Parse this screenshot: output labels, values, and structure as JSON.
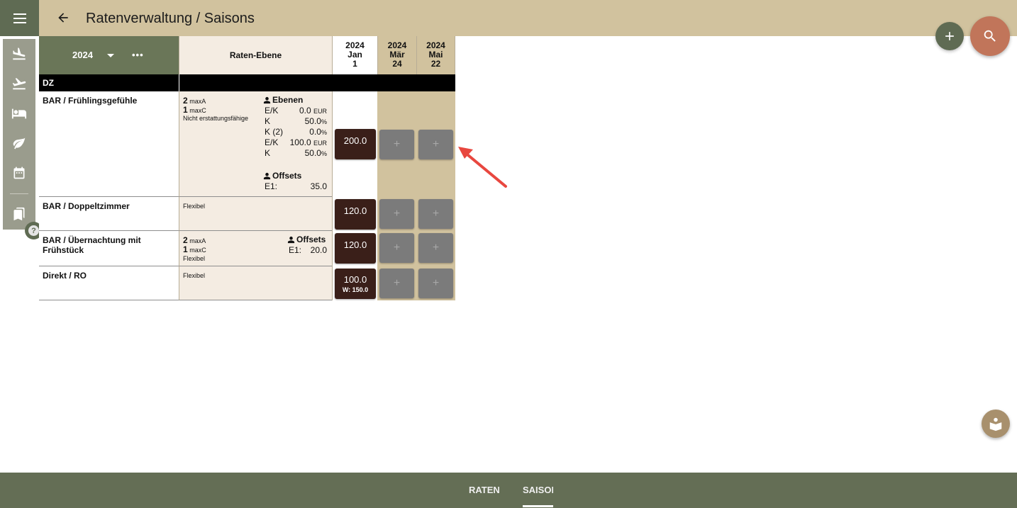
{
  "header": {
    "title": "Ratenverwaltung / Saisons"
  },
  "icons": {
    "menu": "menu-icon",
    "back": "arrow-left-icon",
    "add": "plus-icon",
    "search": "search-icon",
    "nav": [
      "plane-landing-icon",
      "plane-takeoff-icon",
      "bed-icon",
      "leaf-icon",
      "calendar-icon",
      "bookmarks-icon"
    ],
    "help": "help-icon",
    "person": "person-icon",
    "guide": "book-reader-icon",
    "annotation": "red-arrow-icon"
  },
  "help_label": "?",
  "grid": {
    "year": "2024",
    "more": "•••",
    "level_header": "Raten-Ebene",
    "dates": [
      {
        "year": "2024",
        "month": "Jan",
        "day": "1"
      },
      {
        "year": "2024",
        "month": "Mär",
        "day": "24"
      },
      {
        "year": "2024",
        "month": "Mai",
        "day": "22"
      }
    ],
    "category": "DZ",
    "add_symbol": "+",
    "rows": [
      {
        "name": "BAR / Frühlingsgefühle",
        "max_a": "2",
        "max_a_unit": "maxA",
        "max_c": "1",
        "max_c_unit": "maxC",
        "note": "Nicht erstattungsfähige",
        "ebenen_title": "Ebenen",
        "ebenen": [
          {
            "k": "E/K",
            "v": "0.0",
            "u": "EUR"
          },
          {
            "k": "K",
            "v": "50.0",
            "u": "%"
          },
          {
            "k": "K (2)",
            "v": "0.0",
            "u": "%"
          },
          {
            "k": "E/K",
            "v": "100.0",
            "u": "EUR"
          },
          {
            "k": "K",
            "v": "50.0",
            "u": "%"
          }
        ],
        "offsets_title": "Offsets",
        "offsets": [
          {
            "k": "E1:",
            "v": "35.0"
          }
        ],
        "price": "200.0"
      },
      {
        "name": "BAR / Doppeltzimmer",
        "note": "Flexibel",
        "price": "120.0"
      },
      {
        "name": "BAR / Übernachtung mit Frühstück",
        "max_a": "2",
        "max_a_unit": "maxA",
        "max_c": "1",
        "max_c_unit": "maxC",
        "note": "Flexibel",
        "offsets_title": "Offsets",
        "offsets": [
          {
            "k": "E1:",
            "v": "20.0"
          }
        ],
        "price": "120.0"
      },
      {
        "name": "Direkt / RO",
        "note": "Flexibel",
        "price": "100.0",
        "price_sub": "W: 150.0"
      }
    ]
  },
  "tabs": {
    "raten": "RATEN",
    "saisons": "SAISOI"
  },
  "colors": {
    "topbar": "#d1c29e",
    "sidebar": "#9a9c8d",
    "accent_green": "#5f6b53",
    "search_fab": "#c1755a",
    "price_cell": "#3a1f19",
    "annotation_arrow": "#e8473f"
  }
}
